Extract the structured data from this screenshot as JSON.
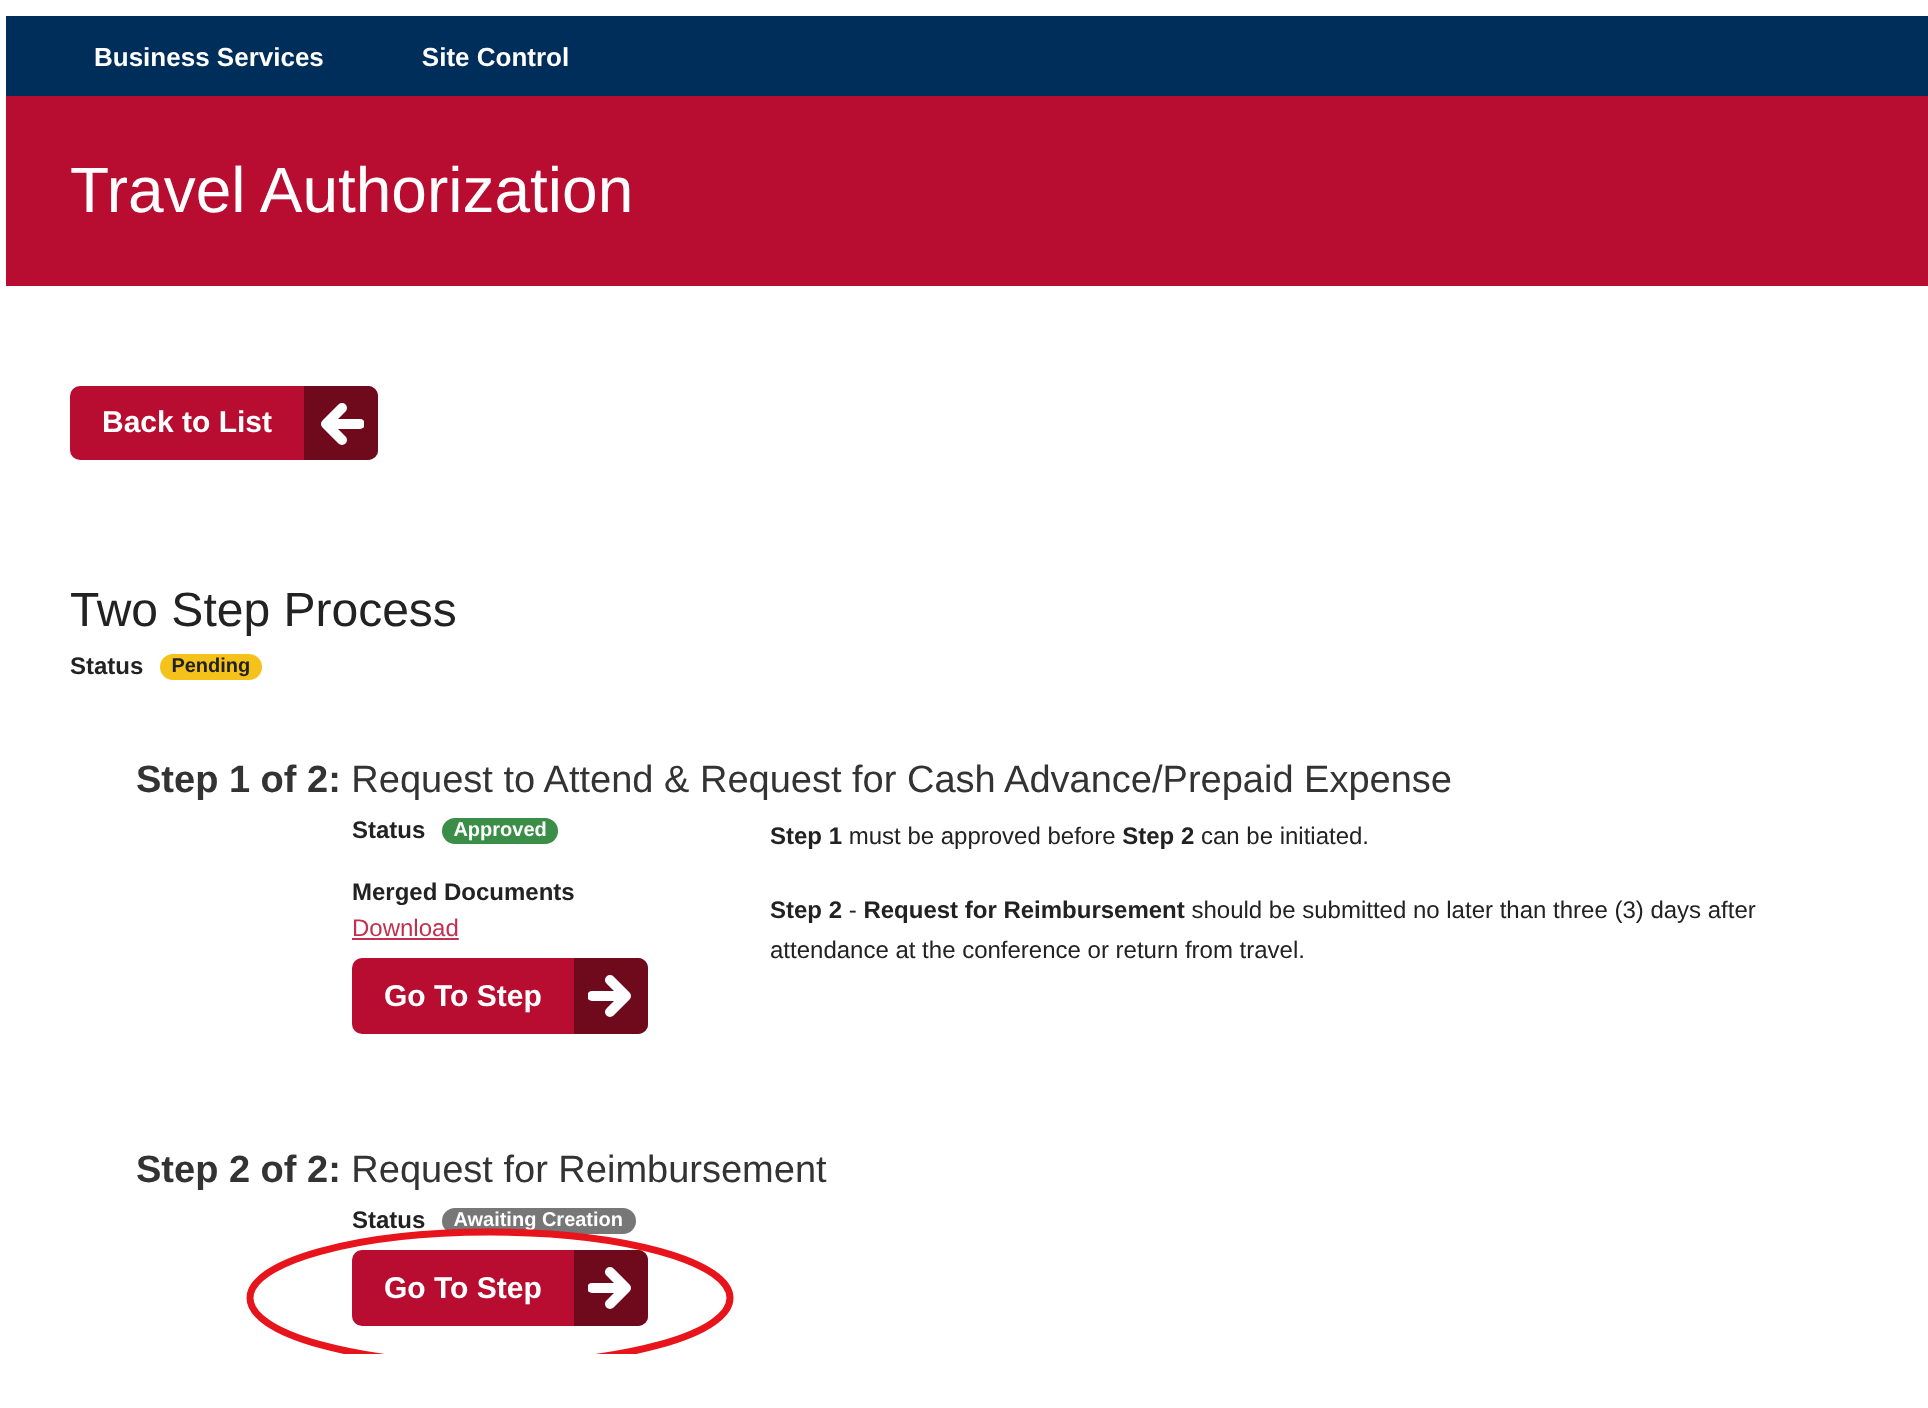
{
  "nav": [
    "Business Services",
    "Site Control"
  ],
  "banner": {
    "title": "Travel Authorization"
  },
  "back_button": {
    "label": "Back to List"
  },
  "process": {
    "title": "Two Step Process",
    "status_label": "Status",
    "status": {
      "text": "Pending",
      "color": "#f5c21b"
    }
  },
  "steps": [
    {
      "number": "Step 1 of 2:",
      "title": "Request to Attend & Request for Cash Advance/Prepaid Expense",
      "status_label": "Status",
      "status": {
        "text": "Approved",
        "color": "#3b8e47"
      },
      "documents_label": "Merged Documents",
      "download": "Download",
      "notes": [
        "**Step 1** must be approved before **Step 2** can be initiated.",
        "**Step 2** - **Request for Reimbursement** should be submitted no later than three (3) days after attendance at the conference or return from travel."
      ],
      "button": "Go To Step",
      "highlighted": false
    },
    {
      "number": "Step 2 of 2:",
      "title": "Request for Reimbursement",
      "status_label": "Status",
      "status": {
        "text": "Awaiting Creation",
        "color": "#777777"
      },
      "button": "Go To Step",
      "highlighted": true
    }
  ]
}
